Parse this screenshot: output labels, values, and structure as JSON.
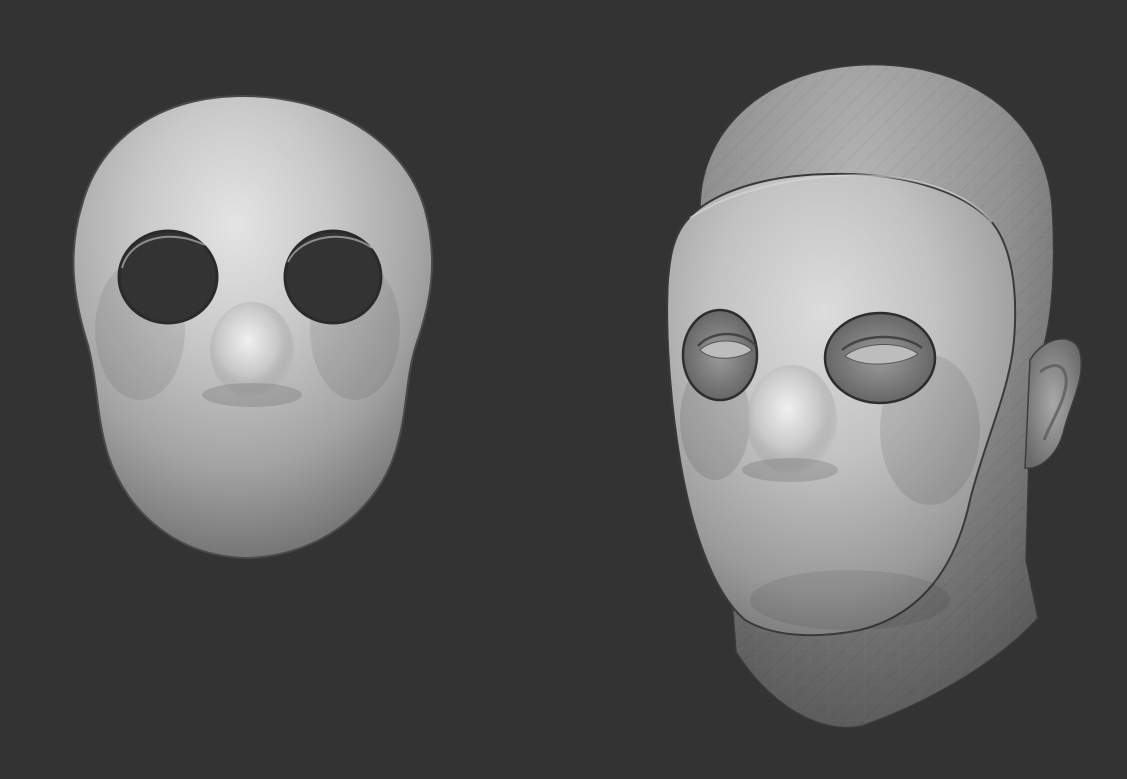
{
  "viewport": {
    "background_color": "#333333",
    "shading": "clay-matcap-grey"
  },
  "models": [
    {
      "name": "mask",
      "description_key": "standalone-mask",
      "color": "#bdbdbd"
    },
    {
      "name": "mask-on-head",
      "description_key": "mask-fitted-on-head",
      "color": "#b0b0b0"
    }
  ]
}
